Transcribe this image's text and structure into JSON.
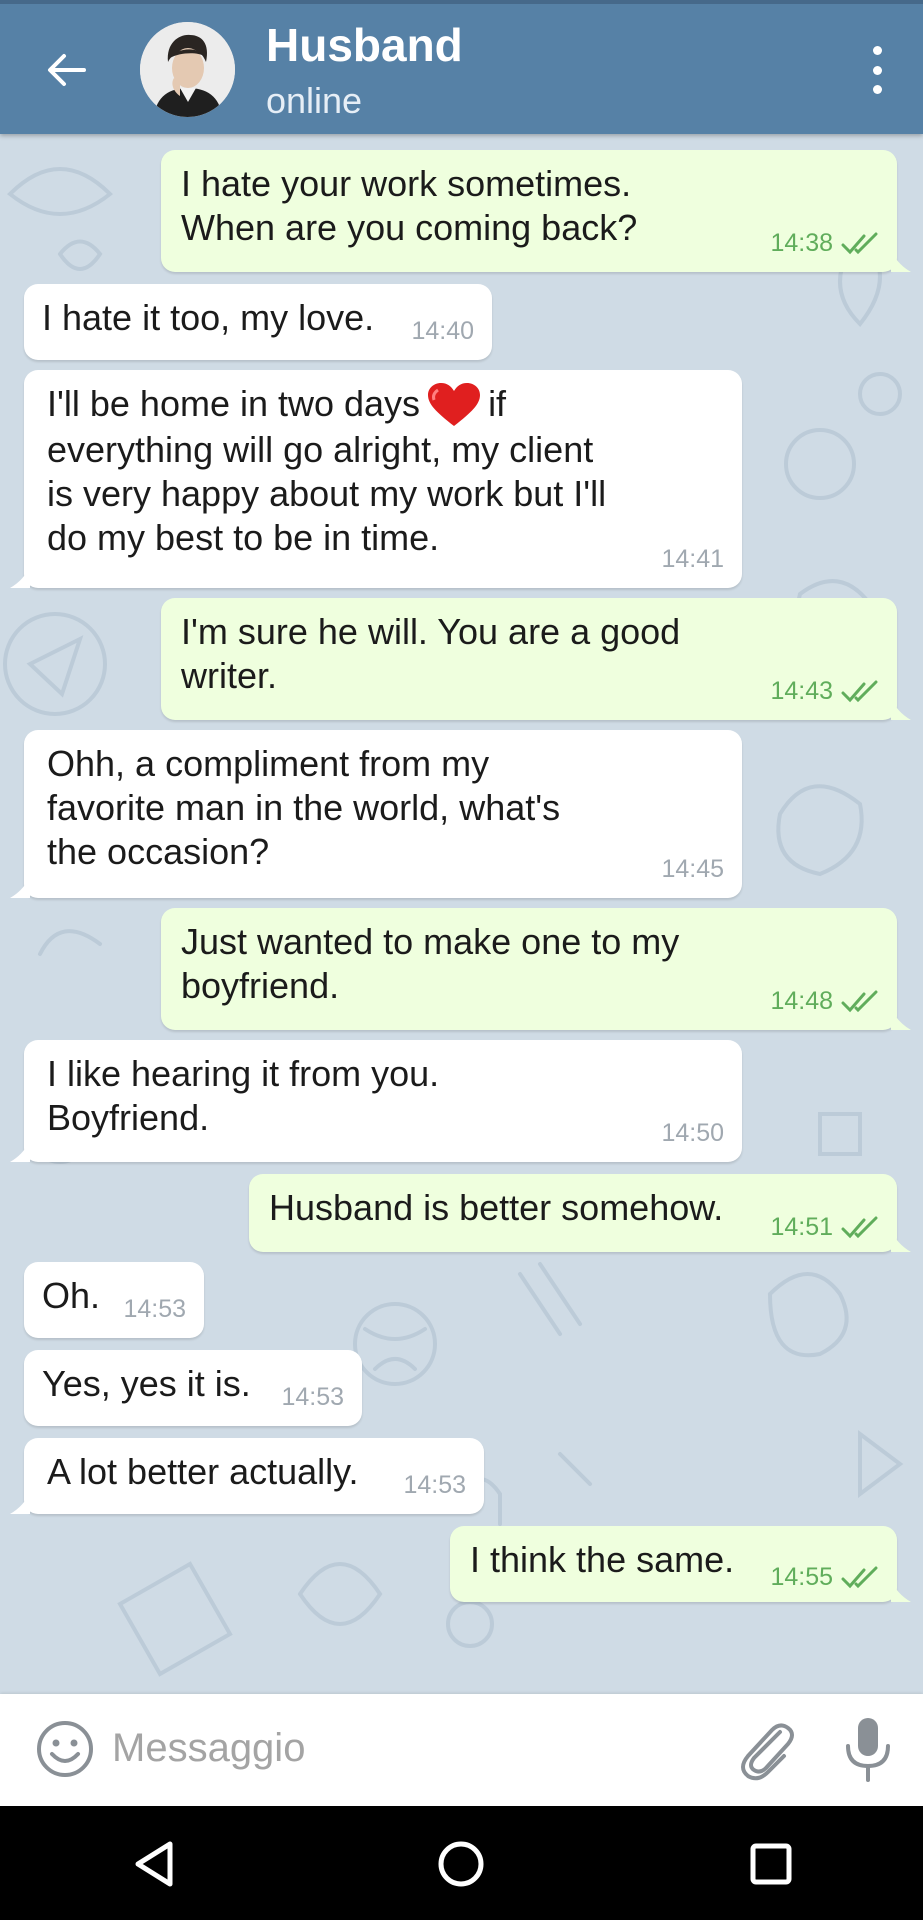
{
  "header": {
    "contact_name": "Husband",
    "status": "online",
    "back_icon": "arrow-left-icon",
    "menu_icon": "more-vertical-icon",
    "bar_color": "#5681a6"
  },
  "messages": [
    {
      "direction": "out",
      "text": "I hate your work sometimes.\nWhen are you coming back?",
      "time": "14:38",
      "read": true
    },
    {
      "direction": "in",
      "text": "I hate it too, my love.",
      "time": "14:40"
    },
    {
      "direction": "in",
      "text_before": "I'll be home in two days",
      "emoji": "red-heart",
      "text_after": "if\neverything will go alright, my client\nis very happy about my work but I'll\ndo my best to be in time.",
      "time": "14:41"
    },
    {
      "direction": "out",
      "text": "I'm sure he will. You are a good\nwriter.",
      "time": "14:43",
      "read": true
    },
    {
      "direction": "in",
      "text": "Ohh, a compliment from my\nfavorite man in the world, what's\nthe occasion?",
      "time": "14:45"
    },
    {
      "direction": "out",
      "text": "Just wanted to make one to my\nboyfriend.",
      "time": "14:48",
      "read": true
    },
    {
      "direction": "in",
      "text": "I like hearing it from you.\nBoyfriend.",
      "time": "14:50"
    },
    {
      "direction": "out",
      "text": "Husband is better somehow.",
      "time": "14:51",
      "read": true
    },
    {
      "direction": "in",
      "text": "Oh.",
      "time": "14:53"
    },
    {
      "direction": "in",
      "text": "Yes, yes it is.",
      "time": "14:53"
    },
    {
      "direction": "in",
      "text": "A lot better actually.",
      "time": "14:53"
    },
    {
      "direction": "out",
      "text": "I think the same.",
      "time": "14:55",
      "read": true
    }
  ],
  "composer": {
    "placeholder": "Messaggio",
    "emoji_icon": "smiley-icon",
    "attach_icon": "paperclip-icon",
    "mic_icon": "microphone-icon"
  },
  "navigation": {
    "back_icon": "nav-back-triangle-icon",
    "home_icon": "nav-home-circle-icon",
    "recent_icon": "nav-recent-square-icon"
  },
  "colors": {
    "incoming_bubble": "#ffffff",
    "outgoing_bubble": "#efffde",
    "outgoing_time": "#60ad5b",
    "chat_background": "#cfdbe5"
  }
}
